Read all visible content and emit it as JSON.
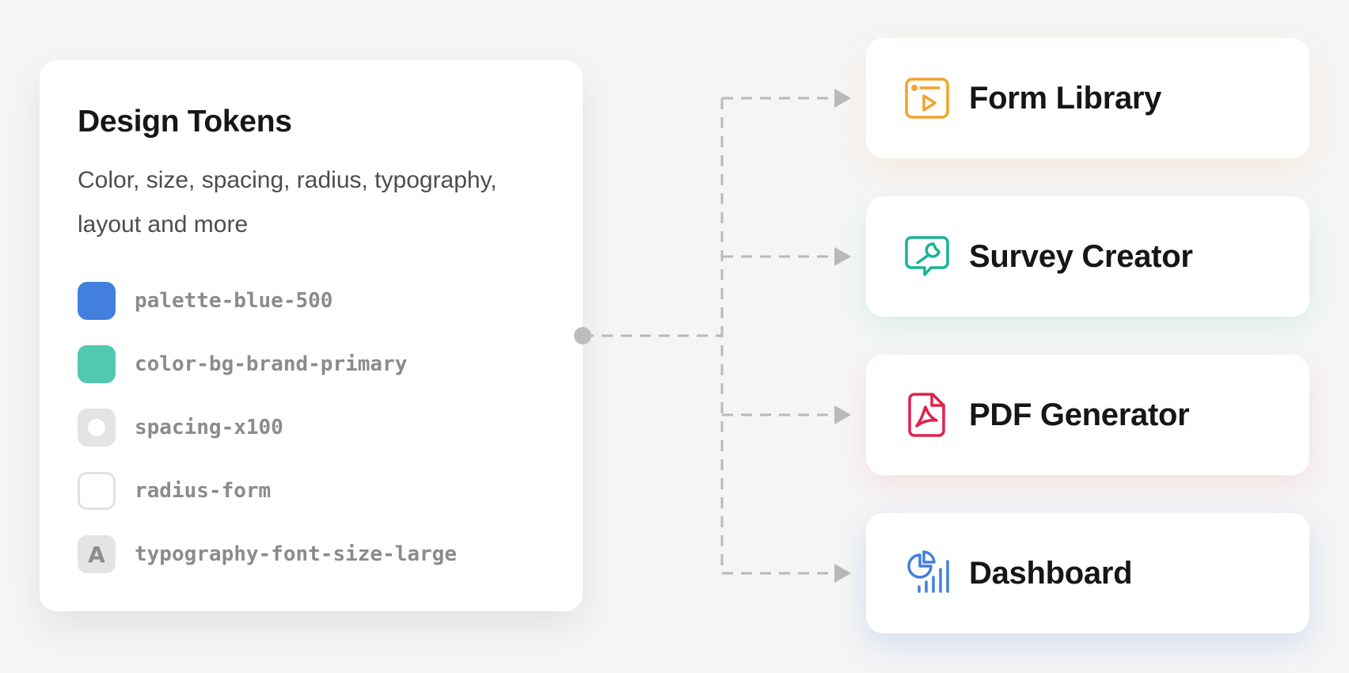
{
  "tokens_card": {
    "title": "Design Tokens",
    "description": "Color, size, spacing, radius, typography, layout and more",
    "tokens": [
      {
        "name": "palette-blue-500",
        "swatch": "color",
        "color": "#437fdc"
      },
      {
        "name": "color-bg-brand-primary",
        "swatch": "color",
        "color": "#51c9b1"
      },
      {
        "name": "spacing-x100",
        "swatch": "spacing-icon"
      },
      {
        "name": "radius-form",
        "swatch": "radius-icon"
      },
      {
        "name": "typography-font-size-large",
        "swatch": "type-icon",
        "glyph": "A"
      }
    ]
  },
  "products": [
    {
      "label": "Form Library",
      "icon": "form-library-icon",
      "accent": "#f4a22d"
    },
    {
      "label": "Survey Creator",
      "icon": "survey-creator-icon",
      "accent": "#19b394"
    },
    {
      "label": "PDF Generator",
      "icon": "pdf-generator-icon",
      "accent": "#e0214b"
    },
    {
      "label": "Dashboard",
      "icon": "dashboard-icon",
      "accent": "#437fdc"
    }
  ],
  "colors": {
    "background": "#f5f5f5",
    "card": "#ffffff",
    "connector": "#b9b9b9",
    "title_text": "#161616",
    "body_text": "#4d4d4d",
    "token_text": "#8b8b8b"
  }
}
